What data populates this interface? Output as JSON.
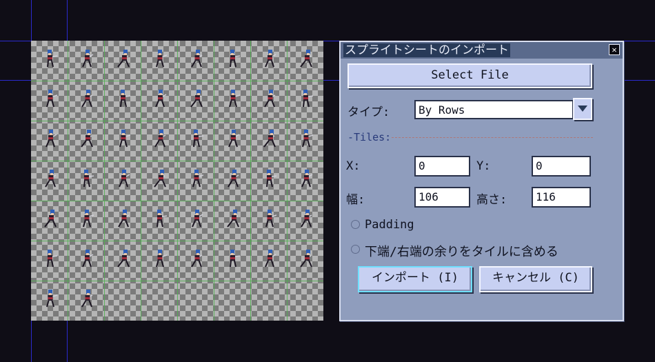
{
  "dialog": {
    "title": "スプライトシートのインポート",
    "close_glyph": "✕",
    "select_file_label": "Select File",
    "type_label": "タイプ:",
    "type_value": "By Rows",
    "tiles_group_label": "-Tiles:",
    "x_label": "X:",
    "x_value": "0",
    "y_label": "Y:",
    "y_value": "0",
    "width_label": "幅:",
    "width_value": "106",
    "height_label": "高さ:",
    "height_value": "116",
    "padding_label": "Padding",
    "padding_checked": false,
    "include_remainder_label": "下端/右端の余りをタイルに含める",
    "include_remainder_checked": false,
    "import_label": "インポート (I)",
    "cancel_label": "キャンセル (C)"
  },
  "sheet": {
    "columns": 8,
    "rows": 7,
    "sprite_count": 50
  },
  "colors": {
    "background": "#0f0d16",
    "guide": "#2b2bd0",
    "grid": "#4fb04f",
    "dialog_bg": "#8f9dbd",
    "title_bg": "#283a58",
    "button_bg": "#c7d0f2"
  }
}
